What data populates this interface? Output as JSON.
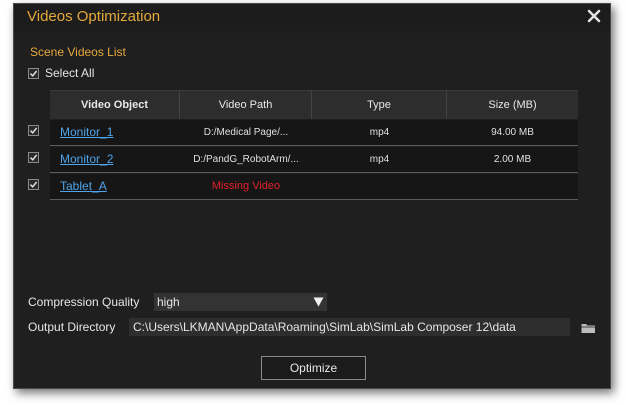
{
  "dialog": {
    "title": "Videos Optimization",
    "close_icon": "close-icon",
    "accent_color": "#e5a93b"
  },
  "scene_list": {
    "section_label": "Scene Videos List",
    "select_all_label": "Select All",
    "select_all_checked": true
  },
  "table": {
    "columns": [
      "Video Object",
      "Video Path",
      "Type",
      "Size (MB)"
    ],
    "rows": [
      {
        "checked": true,
        "object": "Monitor_1",
        "path": "D:/Medical Page/...",
        "type": "mp4",
        "size": "94.00 MB"
      },
      {
        "checked": true,
        "object": "Monitor_2",
        "path": "D:/PandG_RobotArm/...",
        "type": "mp4",
        "size": "2.00 MB"
      },
      {
        "checked": true,
        "object": "Tablet_A",
        "path": "Missing Video",
        "type": "",
        "size": ""
      }
    ],
    "link_color": "#4fa3e8",
    "missing_color": "#e0222a"
  },
  "compression": {
    "label": "Compression Quality",
    "value": "high",
    "icon": "dropdown-arrow-icon"
  },
  "output": {
    "label": "Output Directory",
    "value": "C:\\Users\\LKMAN\\AppData\\Roaming\\SimLab\\SimLab Composer 12\\data",
    "icon": "folder-icon"
  },
  "actions": {
    "optimize_label": "Optimize"
  }
}
